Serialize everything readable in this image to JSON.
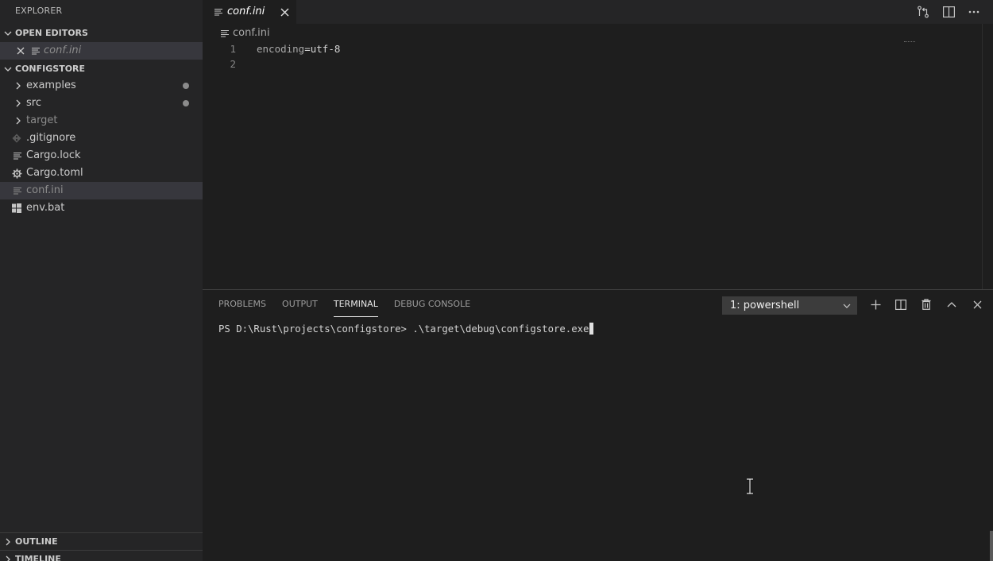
{
  "sidebar": {
    "title": "EXPLORER",
    "open_editors": {
      "header": "OPEN EDITORS",
      "items": [
        {
          "label": "conf.ini"
        }
      ]
    },
    "project": {
      "header": "CONFIGSTORE",
      "items": [
        {
          "label": "examples",
          "kind": "folder",
          "modified": true
        },
        {
          "label": "src",
          "kind": "folder",
          "modified": true
        },
        {
          "label": "target",
          "kind": "folder",
          "modified": false
        },
        {
          "label": ".gitignore",
          "kind": "git-file"
        },
        {
          "label": "Cargo.lock",
          "kind": "text-file"
        },
        {
          "label": "Cargo.toml",
          "kind": "settings-file"
        },
        {
          "label": "conf.ini",
          "kind": "text-file",
          "selected": true
        },
        {
          "label": "env.bat",
          "kind": "windows-file"
        }
      ]
    },
    "outline": {
      "header": "OUTLINE"
    },
    "timeline": {
      "header": "TIMELINE"
    }
  },
  "editor": {
    "tab": {
      "label": "conf.ini"
    },
    "breadcrumb": "conf.ini",
    "lines": [
      {
        "number": "1",
        "key": "encoding",
        "op": "=",
        "value": "utf-8"
      },
      {
        "number": "2",
        "key": "",
        "op": "",
        "value": ""
      }
    ]
  },
  "panel": {
    "tabs": [
      {
        "label": "PROBLEMS"
      },
      {
        "label": "OUTPUT"
      },
      {
        "label": "TERMINAL",
        "active": true
      },
      {
        "label": "DEBUG CONSOLE"
      }
    ],
    "terminal_select": "1: powershell",
    "terminal": {
      "prompt": "PS D:\\Rust\\projects\\configstore> ",
      "command": ".\\target\\debug\\configstore.exe"
    }
  },
  "icons": {
    "tab_close": "close-icon",
    "open_changes": "open-changes-icon",
    "split_editor": "split-editor-icon",
    "more_actions": "more-actions-icon",
    "new_terminal": "plus-icon",
    "split_terminal": "split-terminal-icon",
    "kill_terminal": "trash-icon",
    "maximize_panel": "chevron-up-icon",
    "close_panel": "close-icon"
  },
  "colors": {
    "background": "#1e1e1e",
    "sidebar": "#252526",
    "selection": "#37373d",
    "text": "#cccccc"
  }
}
